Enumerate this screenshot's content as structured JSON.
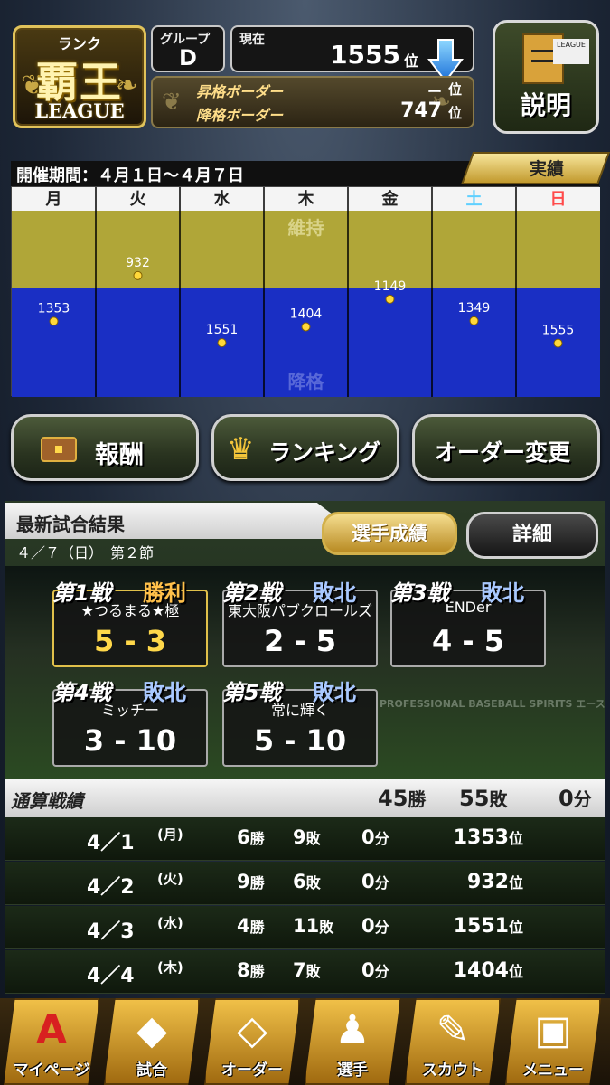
{
  "header": {
    "rank_label": "ランク",
    "rank_name": "覇王",
    "rank_sub": "LEAGUE",
    "group_label": "グループ",
    "group_value": "D",
    "current_label": "現在",
    "current_rank": "1555",
    "current_unit": "位",
    "promotion_label": "昇格ボーダー",
    "promotion_value": "ー",
    "promotion_unit": "位",
    "demotion_label": "降格ボーダー",
    "demotion_value": "747",
    "demotion_unit": "位",
    "help_label": "説明",
    "help_board_text": "LEAGUE"
  },
  "period": {
    "text": "開催期間：４月１日～４月７日",
    "results_tab": "実績"
  },
  "chart_data": {
    "type": "scatter",
    "categories": [
      "月",
      "火",
      "水",
      "木",
      "金",
      "土",
      "日"
    ],
    "values": [
      1353,
      932,
      1551,
      1404,
      1149,
      1349,
      1555
    ],
    "zone_top_label": "維持",
    "zone_bottom_label": "降格",
    "day_colors": [
      "#ffffff",
      "#ffffff",
      "#ffffff",
      "#ffffff",
      "#ffffff",
      "#5fd0ff",
      "#ff4a4a"
    ],
    "y_direction": "rank: smaller is higher"
  },
  "menu": {
    "reward": "報酬",
    "ranking": "ランキング",
    "order_change": "オーダー変更"
  },
  "latest": {
    "title": "最新試合結果",
    "date": "４／７（日）　第２節",
    "players_button": "選手成績",
    "detail_button": "詳細",
    "watermark": "PROFESSIONAL BASEBALL SPIRITS エース",
    "games": [
      {
        "title": "第1戦",
        "result": "勝利",
        "opponent": "★つるまる★極",
        "score": "5 - 3",
        "win": true
      },
      {
        "title": "第2戦",
        "result": "敗北",
        "opponent": "東大阪パブクロールズ",
        "score": "2 - 5",
        "win": false
      },
      {
        "title": "第3戦",
        "result": "敗北",
        "opponent": "ENDer",
        "score": "4 - 5",
        "win": false
      },
      {
        "title": "第4戦",
        "result": "敗北",
        "opponent": "ミッチー",
        "score": "3 - 10",
        "win": false
      },
      {
        "title": "第5戦",
        "result": "敗北",
        "opponent": "常に輝く",
        "score": "5 - 10",
        "win": false
      }
    ]
  },
  "totals": {
    "title": "通算戦績",
    "wins": "45",
    "wins_unit": "勝",
    "losses": "55",
    "losses_unit": "敗",
    "draws": "0",
    "draws_unit": "分",
    "rows": [
      {
        "date": "4／1",
        "dow": "(月)",
        "w": "6",
        "l": "9",
        "d": "0",
        "rank": "1353"
      },
      {
        "date": "4／2",
        "dow": "(火)",
        "w": "9",
        "l": "6",
        "d": "0",
        "rank": "932"
      },
      {
        "date": "4／3",
        "dow": "(水)",
        "w": "4",
        "l": "11",
        "d": "0",
        "rank": "1551"
      },
      {
        "date": "4／4",
        "dow": "(木)",
        "w": "8",
        "l": "7",
        "d": "0",
        "rank": "1404"
      }
    ],
    "w_unit": "勝",
    "l_unit": "敗",
    "d_unit": "分",
    "rank_unit": "位"
  },
  "nav": {
    "items": [
      {
        "label": "マイページ",
        "glyph": "A"
      },
      {
        "label": "試合",
        "glyph": "◆"
      },
      {
        "label": "オーダー",
        "glyph": "◇"
      },
      {
        "label": "選手",
        "glyph": "♟"
      },
      {
        "label": "スカウト",
        "glyph": "✎"
      },
      {
        "label": "メニュー",
        "glyph": "▣"
      }
    ]
  },
  "colors": {
    "maintain_zone": "#b0a638",
    "demote_zone": "#1a2fc4",
    "gold": "#e0c25a"
  }
}
